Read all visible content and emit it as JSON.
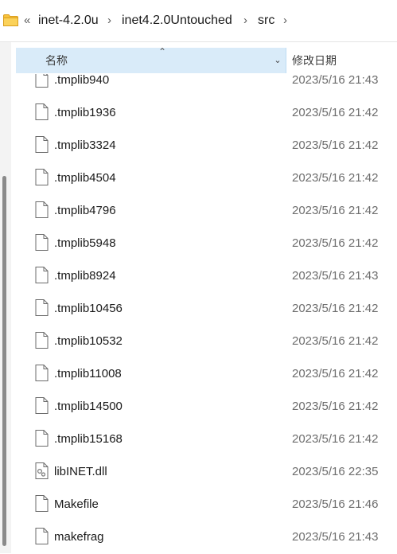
{
  "breadcrumb": {
    "overflow": "«",
    "items": [
      "inet-4.2.0u",
      "inet4.2.0Untouched",
      "src"
    ],
    "separator": "›"
  },
  "columns": {
    "name": "名称",
    "date_modified": "修改日期"
  },
  "files": [
    {
      "name": ".tmplib940",
      "date": "2023/5/16 21:43",
      "icon": "file-icon"
    },
    {
      "name": ".tmplib1936",
      "date": "2023/5/16 21:42",
      "icon": "file-icon"
    },
    {
      "name": ".tmplib3324",
      "date": "2023/5/16 21:42",
      "icon": "file-icon"
    },
    {
      "name": ".tmplib4504",
      "date": "2023/5/16 21:42",
      "icon": "file-icon"
    },
    {
      "name": ".tmplib4796",
      "date": "2023/5/16 21:42",
      "icon": "file-icon"
    },
    {
      "name": ".tmplib5948",
      "date": "2023/5/16 21:42",
      "icon": "file-icon"
    },
    {
      "name": ".tmplib8924",
      "date": "2023/5/16 21:43",
      "icon": "file-icon"
    },
    {
      "name": ".tmplib10456",
      "date": "2023/5/16 21:42",
      "icon": "file-icon"
    },
    {
      "name": ".tmplib10532",
      "date": "2023/5/16 21:42",
      "icon": "file-icon"
    },
    {
      "name": ".tmplib11008",
      "date": "2023/5/16 21:42",
      "icon": "file-icon"
    },
    {
      "name": ".tmplib14500",
      "date": "2023/5/16 21:42",
      "icon": "file-icon"
    },
    {
      "name": ".tmplib15168",
      "date": "2023/5/16 21:42",
      "icon": "file-icon"
    },
    {
      "name": "libINET.dll",
      "date": "2023/5/16 22:35",
      "icon": "dll-file-icon"
    },
    {
      "name": "Makefile",
      "date": "2023/5/16 21:46",
      "icon": "file-icon"
    },
    {
      "name": "makefrag",
      "date": "2023/5/16 21:43",
      "icon": "file-icon"
    }
  ],
  "colors": {
    "header_bg": "#d9ebf9",
    "folder_yellow": "#f8c23c",
    "date_text": "#6d6d6d"
  }
}
